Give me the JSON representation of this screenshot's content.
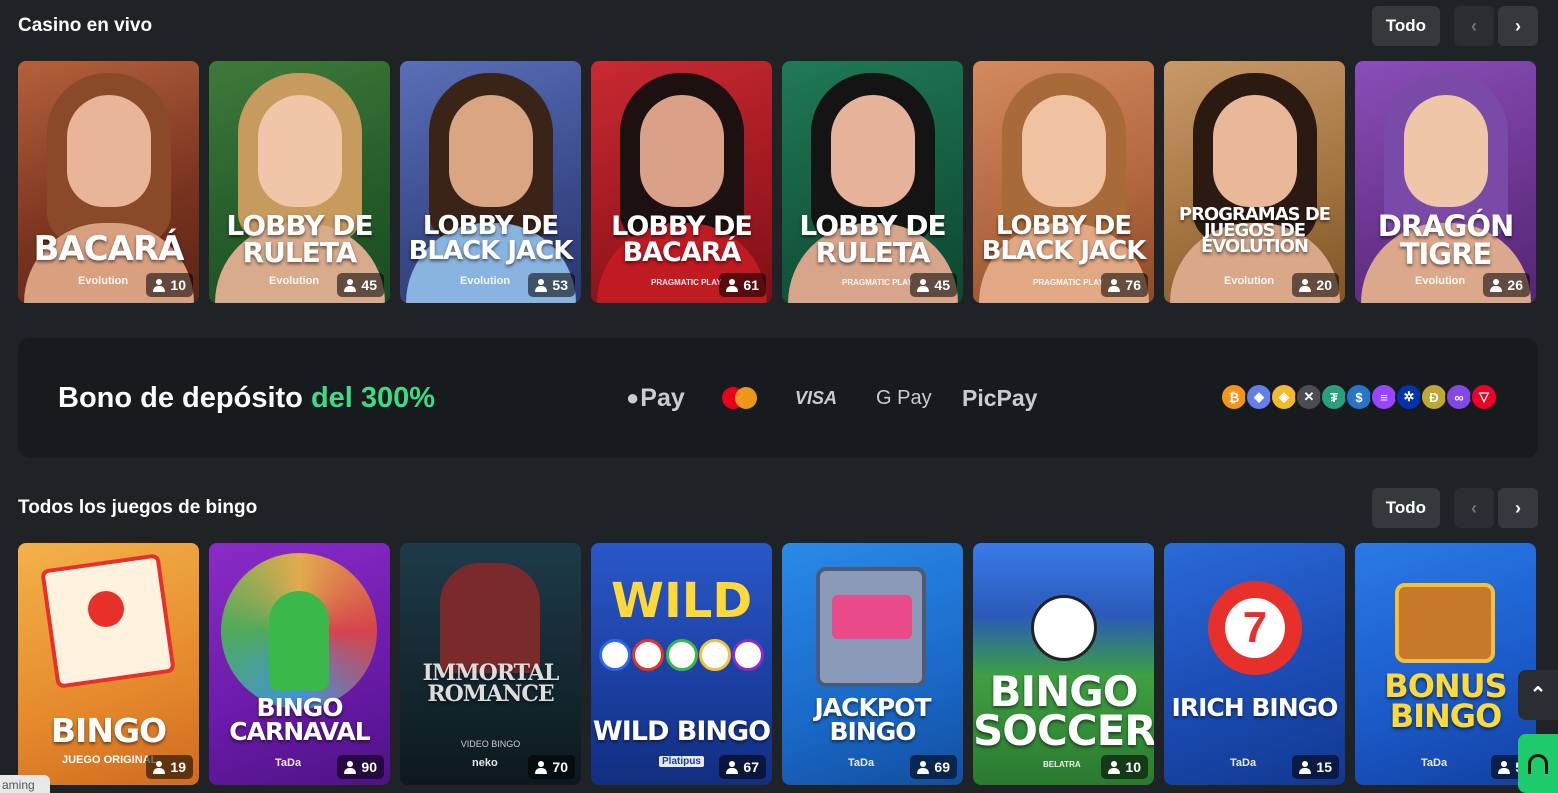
{
  "live_section": {
    "title": "Casino en vivo",
    "all_label": "Todo",
    "prev_icon": "chevron-left-icon",
    "next_icon": "chevron-right-icon",
    "cards": [
      {
        "title": "BACARÁ",
        "brand": "Evolution",
        "players": "10"
      },
      {
        "title": "LOBBY DE RULETA",
        "brand": "Evolution",
        "players": "45"
      },
      {
        "title": "LOBBY DE BLACK JACK",
        "brand": "Evolution",
        "players": "53"
      },
      {
        "title": "LOBBY DE BACARÁ",
        "brand": "PRAGMATIC PLAY",
        "players": "61"
      },
      {
        "title": "LOBBY DE RULETA",
        "brand": "PRAGMATIC PLAY",
        "players": "45"
      },
      {
        "title": "LOBBY DE BLACK JACK",
        "brand": "PRAGMATIC PLAY",
        "players": "76"
      },
      {
        "title": "PROGRAMAS DE JUEGOS DE EVOLUTION",
        "brand": "Evolution",
        "players": "20"
      },
      {
        "title": "DRAGÓN TIGRE",
        "brand": "Evolution",
        "players": "26"
      }
    ]
  },
  "banner": {
    "text_main": "Bono de depósito ",
    "text_highlight": "del 300%",
    "payments": [
      "Pay",
      "VISA",
      "G Pay",
      "PicPay"
    ],
    "crypto": [
      {
        "symbol": "₿",
        "color": "#f7931a"
      },
      {
        "symbol": "◆",
        "color": "#627eea"
      },
      {
        "symbol": "◈",
        "color": "#f3ba2f"
      },
      {
        "symbol": "✕",
        "color": "#4a4e52"
      },
      {
        "symbol": "₮",
        "color": "#26a17b"
      },
      {
        "symbol": "$",
        "color": "#2775ca"
      },
      {
        "symbol": "≡",
        "color": "#9945ff"
      },
      {
        "symbol": "✲",
        "color": "#0033ad"
      },
      {
        "symbol": "Ð",
        "color": "#c2a633"
      },
      {
        "symbol": "∞",
        "color": "#8247e5"
      },
      {
        "symbol": "▽",
        "color": "#ef0027"
      }
    ]
  },
  "bingo_section": {
    "title": "Todos los juegos de bingo",
    "all_label": "Todo",
    "cards": [
      {
        "title": "BINGO",
        "subtitle": "JUEGO ORIGINAL",
        "players": "19"
      },
      {
        "title": "BINGO CARNAVAL",
        "brand": "TaDa",
        "players": "90"
      },
      {
        "title": "IMMORTAL ROMANCE",
        "subtitle": "VIDEO BINGO",
        "brand": "neko",
        "players": "70"
      },
      {
        "title": "WILD BINGO",
        "brand": "Platipus",
        "players": "67"
      },
      {
        "title": "JACKPOT BINGO",
        "brand": "TaDa",
        "players": "69"
      },
      {
        "title": "BINGO SOCCER",
        "brand": "BELATRA",
        "players": "10"
      },
      {
        "title": "IRICH BINGO",
        "brand": "TaDa",
        "players": "15"
      },
      {
        "title": "BONUS BINGO",
        "brand": "TaDa",
        "players": "5"
      }
    ]
  },
  "footer_tag": "aming"
}
